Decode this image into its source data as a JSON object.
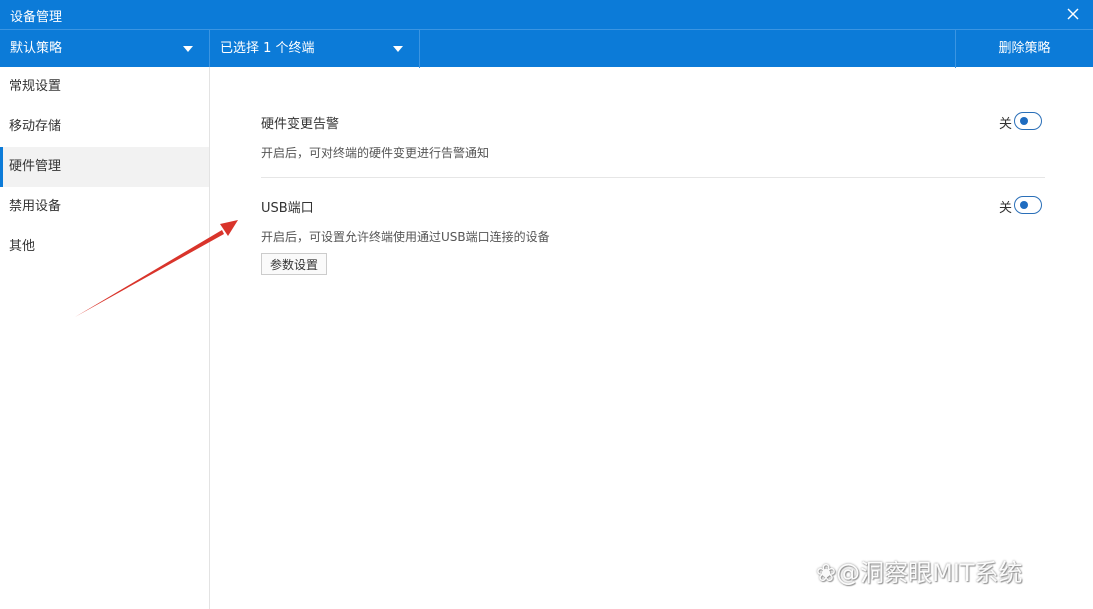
{
  "window": {
    "title": "设备管理",
    "accent_color": "#0c7bd8"
  },
  "toolbar": {
    "policy_select": "默认策略",
    "terminal_select": "已选择 1 个终端",
    "delete_label": "删除策略"
  },
  "sidebar": {
    "items": [
      {
        "label": "常规设置",
        "active": false
      },
      {
        "label": "移动存储",
        "active": false
      },
      {
        "label": "硬件管理",
        "active": true
      },
      {
        "label": "禁用设备",
        "active": false
      },
      {
        "label": "其他",
        "active": false
      }
    ]
  },
  "settings": [
    {
      "title": "硬件变更告警",
      "description": "开启后，可对终端的硬件变更进行告警通知",
      "toggle_label": "关",
      "enabled": false
    },
    {
      "title": "USB端口",
      "description": "开启后，可设置允许终端使用通过USB端口连接的设备",
      "toggle_label": "关",
      "enabled": false,
      "button_label": "参数设置"
    }
  ],
  "annotation": {
    "arrow_color": "#d9342b"
  },
  "watermark": {
    "text": "洞察眼MIT系统"
  }
}
